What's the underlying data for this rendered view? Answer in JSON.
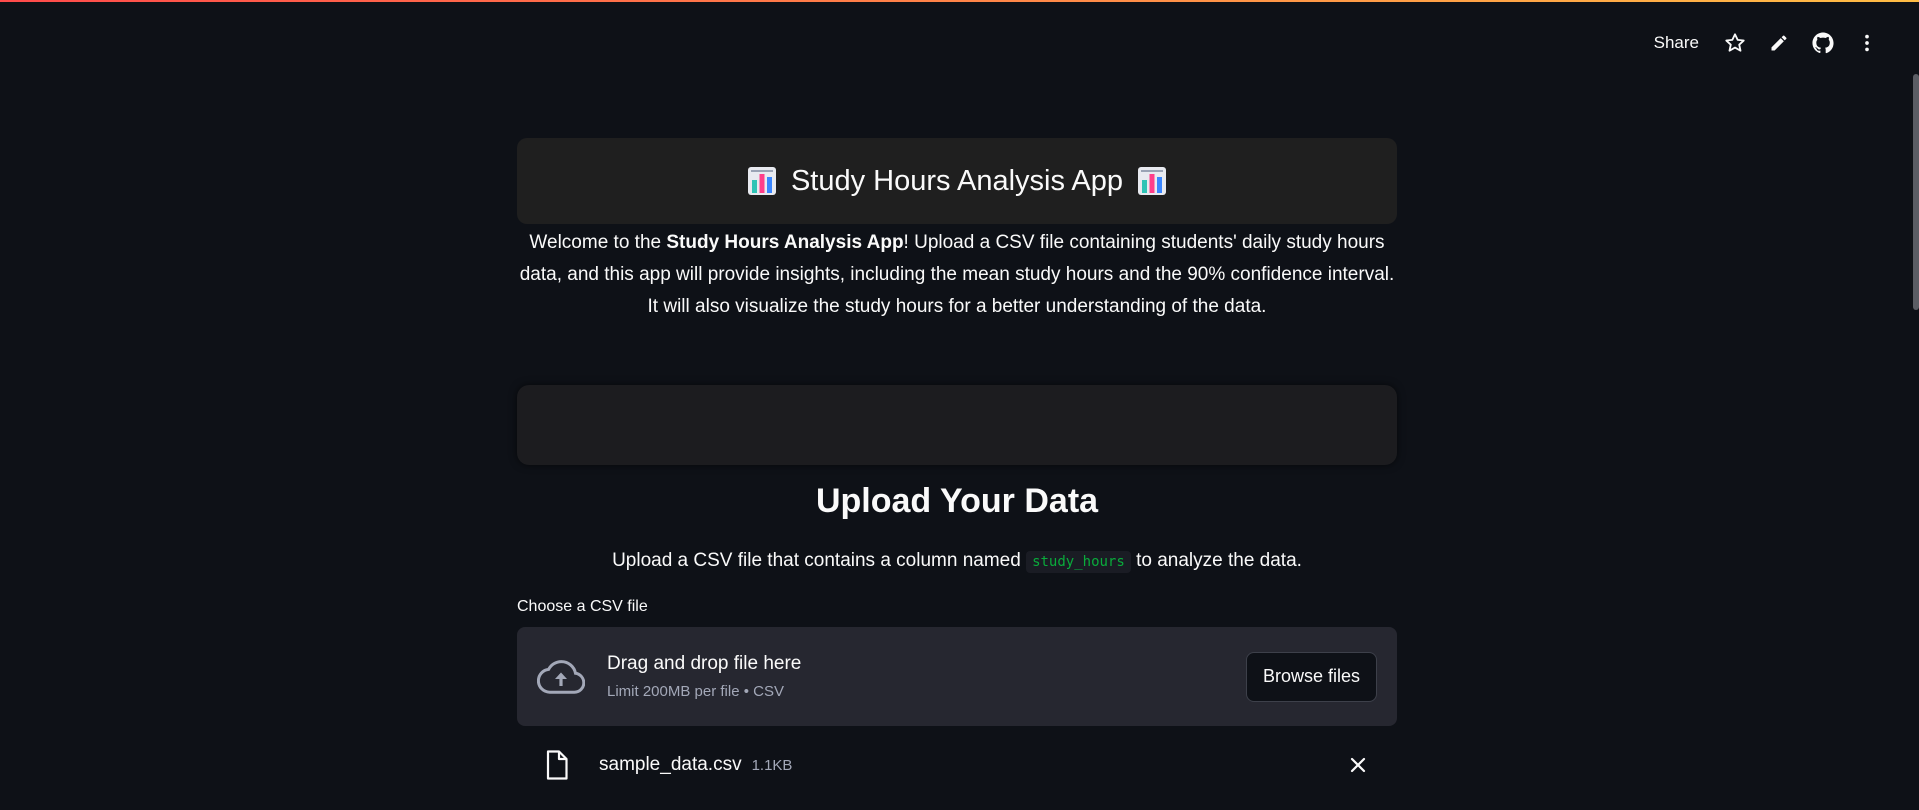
{
  "toolbar": {
    "share_label": "Share",
    "icons": [
      "star-icon",
      "pencil-icon",
      "github-icon",
      "more-vertical-icon"
    ]
  },
  "header": {
    "title": "Study Hours Analysis App",
    "emoji_icon": "bar-chart-emoji-icon"
  },
  "intro": {
    "prefix": "Welcome to the ",
    "bold": "Study Hours Analysis App",
    "suffix": "! Upload a CSV file containing students' daily study hours data, and this app will provide insights, including the mean study hours and the 90% confidence interval. It will also visualize the study hours for a better understanding of the data."
  },
  "upload_section": {
    "title": "Upload Your Data",
    "desc_prefix": "Upload a CSV file that contains a column named ",
    "desc_code": "study_hours",
    "desc_suffix": " to analyze the data."
  },
  "uploader": {
    "label": "Choose a CSV file",
    "drag_text": "Drag and drop file here",
    "limit_text": "Limit 200MB per file • CSV",
    "browse_label": "Browse files"
  },
  "uploaded_file": {
    "name": "sample_data.csv",
    "size": "1.1KB"
  },
  "colors": {
    "background": "#0e1117",
    "panel": "#262730",
    "code_text": "#09ab3b",
    "accent": "#ff4b4b"
  }
}
